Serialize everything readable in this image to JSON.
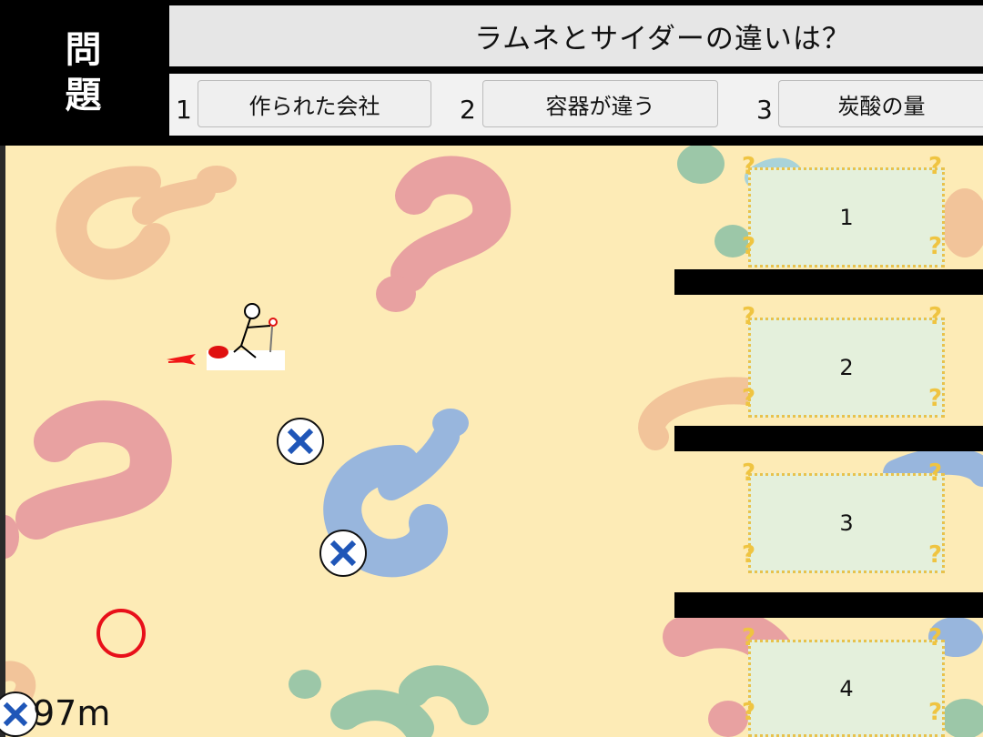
{
  "header": {
    "label_line1": "問",
    "label_line2": "題",
    "question": "ラムネとサイダーの違いは？"
  },
  "choices": [
    {
      "number": "1",
      "label": "作られた会社"
    },
    {
      "number": "2",
      "label": "容器が違う"
    },
    {
      "number": "3",
      "label": "炭酸の量"
    }
  ],
  "answer_panels": [
    "1",
    "2",
    "3",
    "4"
  ],
  "hud": {
    "distance": "97m"
  },
  "colors": {
    "background": "#fdebb6",
    "panel": "#e4f0dc",
    "panel_border": "#e8c24c",
    "correct_ring": "#e8101a",
    "wrong_cross": "#1f56b8"
  }
}
